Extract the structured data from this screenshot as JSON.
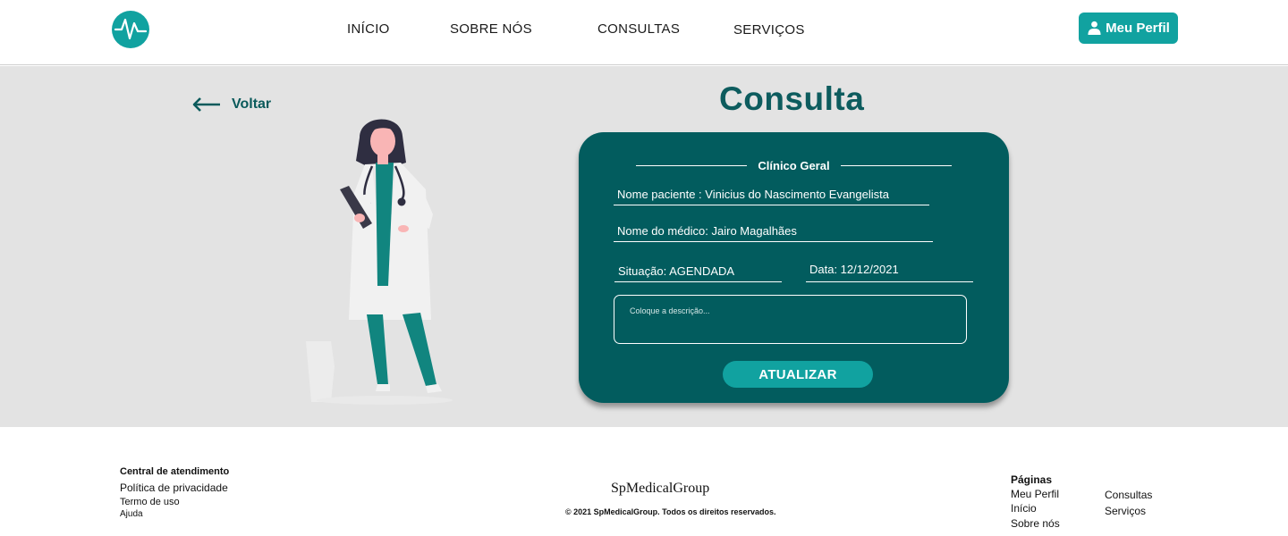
{
  "header": {
    "logo_icon": "heartbeat-logo-icon",
    "nav": [
      "INÍCIO",
      "SOBRE NÓS",
      "CONSULTAS",
      "SERVIÇOS"
    ],
    "profile_button": "Meu Perfil",
    "profile_icon": "user-icon"
  },
  "main": {
    "back_label": "Voltar",
    "back_icon": "arrow-left-icon",
    "title": "Consulta",
    "card": {
      "specialty": "Clínico Geral",
      "patient": "Nome paciente :  Vinicius do Nascimento Evangelista",
      "doctor": "Nome do médico: Jairo Magalhães",
      "status": "Situação: AGENDADA",
      "date": "Data: 12/12/2021",
      "description_placeholder": "Coloque a descrição...",
      "update_button": "ATUALIZAR"
    }
  },
  "footer": {
    "left": {
      "heading": "Central de atendimento",
      "links": [
        "Política de privacidade",
        "Termo de uso",
        "Ajuda"
      ]
    },
    "brand": "SpMedicalGroup",
    "copyright": "© 2021 SpMedicalGroup. Todos os direitos reservados.",
    "pages": {
      "heading": "Páginas",
      "col1": [
        "Meu Perfil",
        "Início",
        "Sobre nós"
      ],
      "col2": [
        "Consultas",
        "Serviços"
      ]
    }
  },
  "colors": {
    "brand_teal": "#11a2a0",
    "card_dark_teal": "#025c5e",
    "title_teal": "#0d5c5e",
    "main_background": "#e3e3e3"
  }
}
